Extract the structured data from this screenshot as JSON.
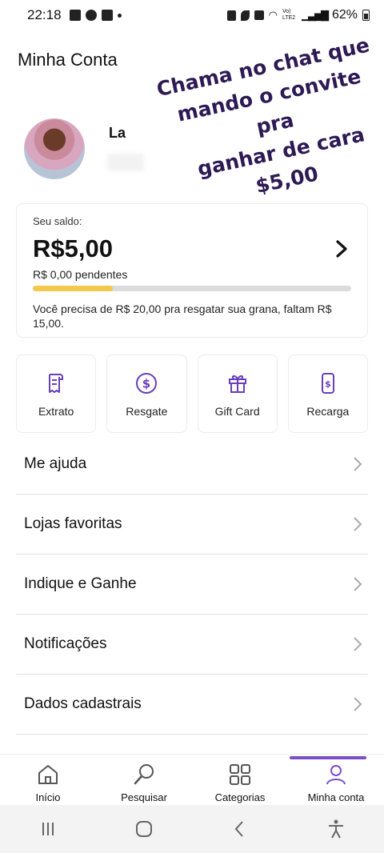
{
  "status_bar": {
    "time": "22:18",
    "battery": "62%",
    "network": "Vo) LTE2"
  },
  "header": {
    "title": "Minha Conta"
  },
  "profile": {
    "name": "La"
  },
  "overlay": {
    "line1": "Chama no chat que",
    "line2": "mando o convite pra",
    "line3": "ganhar de cara $5,00"
  },
  "balance": {
    "label": "Seu saldo:",
    "value": "R$5,00",
    "pending": "R$ 0,00 pendentes",
    "progress": 0.25,
    "need_text": "Você precisa de R$ 20,00 pra resgatar sua grana, faltam R$ 15,00."
  },
  "actions": [
    {
      "label": "Extrato",
      "icon": "receipt-icon"
    },
    {
      "label": "Resgate",
      "icon": "dollar-circle-icon"
    },
    {
      "label": "Gift Card",
      "icon": "gift-icon"
    },
    {
      "label": "Recarga",
      "icon": "phone-dollar-icon"
    }
  ],
  "menu": [
    {
      "label": "Me ajuda"
    },
    {
      "label": "Lojas favoritas"
    },
    {
      "label": "Indique e Ganhe"
    },
    {
      "label": "Notificações"
    },
    {
      "label": "Dados cadastrais"
    }
  ],
  "bottom_nav": [
    {
      "label": "Início",
      "icon": "home-icon"
    },
    {
      "label": "Pesquisar",
      "icon": "search-icon"
    },
    {
      "label": "Categorias",
      "icon": "grid-icon"
    },
    {
      "label": "Minha conta",
      "icon": "user-icon",
      "active": true
    }
  ],
  "colors": {
    "accent": "#7a4fc7",
    "progress": "#f2c94c",
    "overlay_text": "#2d1a54"
  }
}
